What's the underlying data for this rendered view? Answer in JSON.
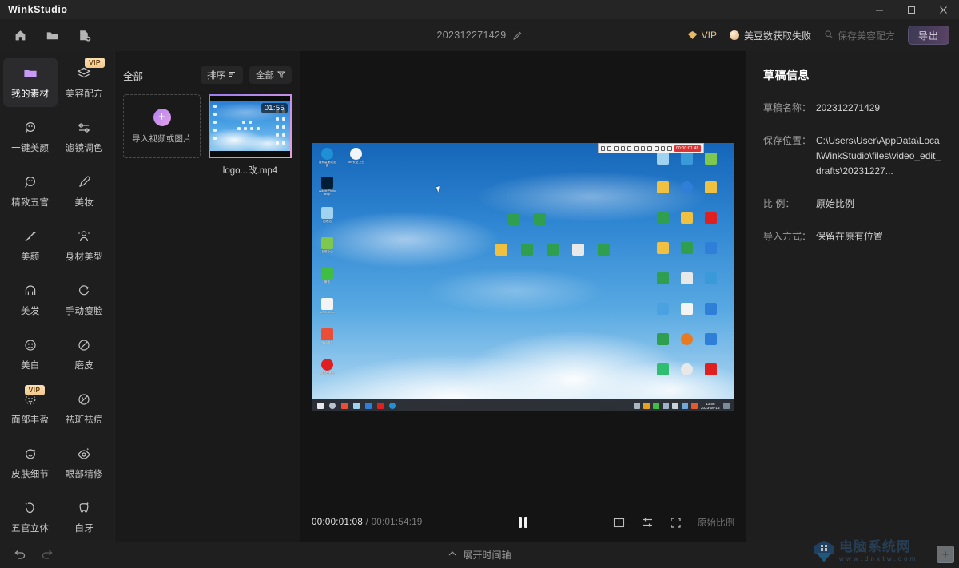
{
  "app": {
    "brand": "WinkStudio",
    "window_controls": [
      {
        "name": "minimize",
        "glyph": "—"
      },
      {
        "name": "maximize",
        "glyph": "□"
      },
      {
        "name": "close",
        "glyph": "✕"
      }
    ]
  },
  "toolbar": {
    "icons": [
      {
        "name": "home-icon",
        "label": "首页"
      },
      {
        "name": "folder-icon",
        "label": "打开项目"
      },
      {
        "name": "new-file-icon",
        "label": "新建项目"
      }
    ],
    "project_name": "202312271429",
    "edit_icon": "pencil-icon",
    "vip_label": "VIP",
    "bean_status": "美豆数获取失败",
    "save_recipe_label": "保存美容配方",
    "export_label": "导出"
  },
  "rail": {
    "tools": [
      {
        "label": "我的素材",
        "icon": "folder-icon",
        "active": true,
        "vip": false
      },
      {
        "label": "美容配方",
        "icon": "layers-icon",
        "active": false,
        "vip": true
      },
      {
        "label": "一键美颜",
        "icon": "magic-face-icon",
        "active": false,
        "vip": false
      },
      {
        "label": "滤镜调色",
        "icon": "sliders-icon",
        "active": false,
        "vip": false
      },
      {
        "label": "精致五官",
        "icon": "face-outline-icon",
        "active": false,
        "vip": false
      },
      {
        "label": "美妆",
        "icon": "brush-icon",
        "active": false,
        "vip": false
      },
      {
        "label": "美颜",
        "icon": "wand-icon",
        "active": false,
        "vip": false
      },
      {
        "label": "身材美型",
        "icon": "body-icon",
        "active": false,
        "vip": false
      },
      {
        "label": "美发",
        "icon": "hair-icon",
        "active": false,
        "vip": false
      },
      {
        "label": "手动瘦脸",
        "icon": "slim-face-icon",
        "active": false,
        "vip": false
      },
      {
        "label": "美白",
        "icon": "whiten-icon",
        "active": false,
        "vip": false
      },
      {
        "label": "磨皮",
        "icon": "smooth-skin-icon",
        "active": false,
        "vip": false
      },
      {
        "label": "面部丰盈",
        "icon": "face-fill-icon",
        "active": false,
        "vip": true
      },
      {
        "label": "祛斑祛痘",
        "icon": "blemish-icon",
        "active": false,
        "vip": false
      },
      {
        "label": "皮肤细节",
        "icon": "skin-detail-icon",
        "active": false,
        "vip": false
      },
      {
        "label": "眼部精修",
        "icon": "eye-icon",
        "active": false,
        "vip": false
      },
      {
        "label": "五官立体",
        "icon": "contour-icon",
        "active": false,
        "vip": false
      },
      {
        "label": "白牙",
        "icon": "tooth-icon",
        "active": false,
        "vip": false
      }
    ],
    "vip_badge": "VIP"
  },
  "media": {
    "title": "全部",
    "sort_label": "排序",
    "filter_label": "全部",
    "import_label": "导入视频或图片",
    "items": [
      {
        "name": "logo...改.mp4",
        "duration": "01:55",
        "selected": true
      }
    ]
  },
  "preview": {
    "desktop_icons_left": [
      {
        "caption": "搜狗高速浏览器",
        "color": "#1f8fd6"
      },
      {
        "caption": "360安全卫士",
        "color": "#f7f7f7"
      },
      {
        "caption": "Adobe Photoshop",
        "color": "#001e36"
      },
      {
        "caption": "回收站",
        "color": "#cfe6f6"
      },
      {
        "caption": "日常办公",
        "color": "#7ec850"
      },
      {
        "caption": "微信",
        "color": "#3fbe41"
      },
      {
        "caption": "WPS Office",
        "color": "#f4f4f4"
      },
      {
        "caption": "驱动精灵",
        "color": "#e94f37"
      },
      {
        "caption": "网易云音乐",
        "color": "#e02020"
      }
    ],
    "recorder_time": "00:00:01.48",
    "taskbar_clock": "13:56",
    "taskbar_date": "2023-08-15"
  },
  "player": {
    "current_time": "00:00:01:08",
    "total_time": "00:01:54:19",
    "separator": "/",
    "state": "paused",
    "controls": [
      {
        "name": "split-view-icon"
      },
      {
        "name": "adjust-icon"
      },
      {
        "name": "fullscreen-icon"
      }
    ],
    "ratio_label": "原始比例"
  },
  "info": {
    "title": "草稿信息",
    "rows": [
      {
        "key": "草稿名称：",
        "value": "202312271429"
      },
      {
        "key": "保存位置：",
        "value": "C:\\Users\\User\\AppData\\Local\\WinkStudio\\files\\video_edit_drafts\\20231227..."
      },
      {
        "key": "比    例：",
        "value": "原始比例"
      },
      {
        "key": "导入方式：",
        "value": "保留在原有位置"
      }
    ]
  },
  "bottombar": {
    "undo_icon": "undo-icon",
    "redo_icon": "redo-icon",
    "expand_label": "展开时间轴",
    "chevron_icon": "chevron-up-icon"
  },
  "watermark": {
    "name_cn": "电脑系统网",
    "url": "www.dnxtw.com",
    "plus_glyph": "+"
  },
  "colors": {
    "accent": "#b37ef0",
    "vip_gold": "#f2c78b",
    "bg": "#1e1e1e",
    "export": "#5a4466"
  }
}
